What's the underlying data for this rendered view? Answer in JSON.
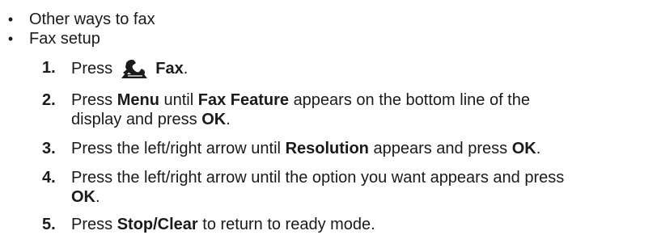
{
  "bullets": [
    {
      "text": "Other ways to fax"
    },
    {
      "text": "Fax setup"
    }
  ],
  "bullet_glyph": "•",
  "steps": [
    {
      "num": "1.",
      "pre": "Press",
      "icon": "fax-handset-icon",
      "button": "Fax",
      "post": "."
    },
    {
      "num": "2.",
      "pre": "Press",
      "b1": "Menu",
      "mid1": "until",
      "b2": "Fax Feature",
      "mid2": "appears on the bottom line of the",
      "line2_pre": "display and press",
      "b3": "OK",
      "end": "."
    },
    {
      "num": "3.",
      "pre": "Press the left/right arrow until",
      "b1": "Resolution",
      "mid1": "appears and press",
      "b2": "OK",
      "end": "."
    },
    {
      "num": "4.",
      "pre": "Press the left/right arrow until the option you want appears and press",
      "b1": "OK",
      "end": "."
    },
    {
      "num": "5.",
      "pre": "Press",
      "b1": "Stop/Clear",
      "mid1": "to return to ready mode."
    }
  ],
  "colors": {
    "text": "#1a1a1a",
    "icon_dark": "#1a1a1a",
    "icon_light": "#ffffff"
  }
}
